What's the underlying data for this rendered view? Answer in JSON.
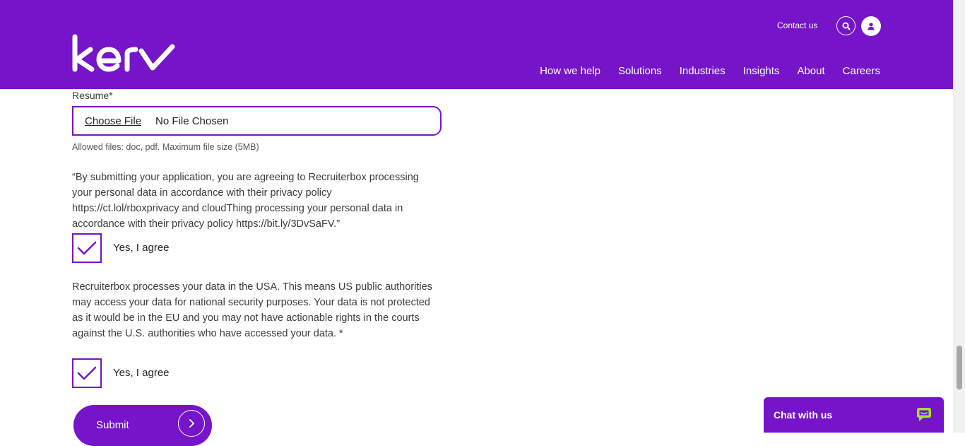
{
  "header": {
    "logo_text": "kerv",
    "contact_label": "Contact us",
    "nav": [
      "How we help",
      "Solutions",
      "Industries",
      "Insights",
      "About",
      "Careers"
    ]
  },
  "form": {
    "resume_label": "Resume*",
    "choose_file_label": "Choose File",
    "file_status": "No File Chosen",
    "allowed_hint": "Allowed files: doc, pdf. Maximum file size (5MB)",
    "consent1_text": "“By submitting your application, you are agreeing to Recruiterbox processing your personal data in accordance with their privacy policy https://ct.lol/rboxprivacy and cloudThing processing your personal data in accordance with their privacy policy https://bit.ly/3DvSaFV.”",
    "consent1_label": "Yes, I agree",
    "consent1_checked": true,
    "consent2_text": "Recruiterbox processes your data in the USA. This means US public authorities may access your data for national security purposes. Your data is not protected as it would be in the EU and you may not have actionable rights in the courts against the U.S. authorities who have accessed your data. *",
    "consent2_label": "Yes, I agree",
    "consent2_checked": true,
    "submit_label": "Submit"
  },
  "chat": {
    "label": "Chat with us"
  },
  "colors": {
    "brand": "#7514c9",
    "chat_icon": "#a4e22f"
  }
}
